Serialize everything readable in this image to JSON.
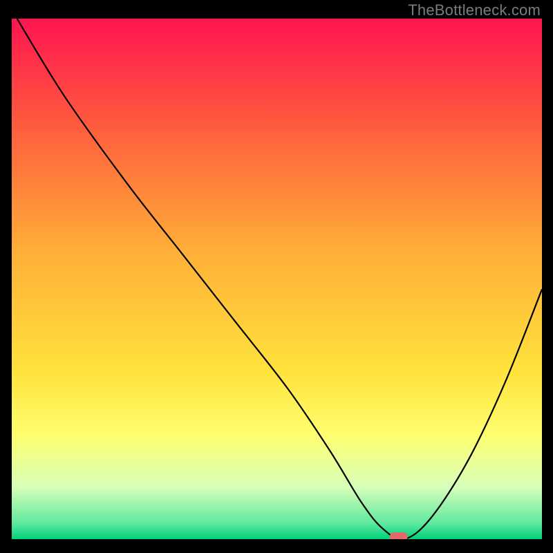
{
  "watermark": "TheBottleneck.com",
  "chart_data": {
    "type": "line",
    "title": "",
    "xlabel": "",
    "ylabel": "",
    "xlim": [
      0,
      100
    ],
    "ylim": [
      0,
      100
    ],
    "grid": false,
    "legend": false,
    "gradient_stops": [
      {
        "offset": 0,
        "color": "#ff1450"
      },
      {
        "offset": 20,
        "color": "#ff5a3e"
      },
      {
        "offset": 45,
        "color": "#ffb038"
      },
      {
        "offset": 68,
        "color": "#ffe33c"
      },
      {
        "offset": 80,
        "color": "#ffff70"
      },
      {
        "offset": 90,
        "color": "#d7ffb9"
      },
      {
        "offset": 97,
        "color": "#5fe89e"
      },
      {
        "offset": 100,
        "color": "#00d07a"
      }
    ],
    "series": [
      {
        "name": "bottleneck-curve",
        "color": "#000000",
        "x": [
          1,
          10,
          22,
          32,
          42,
          52,
          60,
          66,
          70,
          74,
          79,
          86,
          93,
          100
        ],
        "values": [
          100,
          85,
          68,
          55,
          42,
          29,
          17,
          7,
          2,
          0,
          4,
          15,
          30,
          48
        ]
      }
    ],
    "marker": {
      "x": 73,
      "y": 0.5,
      "color": "#e26a6a"
    }
  }
}
